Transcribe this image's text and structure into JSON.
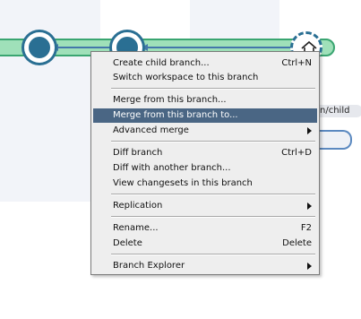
{
  "graph": {
    "child_branch_label": "n/child"
  },
  "context_menu": {
    "items": [
      {
        "label": "Create child branch...",
        "shortcut": "Ctrl+N"
      },
      {
        "label": "Switch workspace to this branch",
        "shortcut": ""
      },
      {
        "label": "Merge from this branch...",
        "shortcut": ""
      },
      {
        "label": "Merge from this branch to...",
        "shortcut": "",
        "selected": true
      },
      {
        "label": "Advanced merge",
        "shortcut": "",
        "submenu": true
      },
      {
        "label": "Diff branch",
        "shortcut": "Ctrl+D"
      },
      {
        "label": "Diff with another branch...",
        "shortcut": ""
      },
      {
        "label": "View changesets in this branch",
        "shortcut": ""
      },
      {
        "label": "Replication",
        "shortcut": "",
        "submenu": true
      },
      {
        "label": "Rename...",
        "shortcut": "F2"
      },
      {
        "label": "Delete",
        "shortcut": "Delete"
      },
      {
        "label": "Branch Explorer",
        "shortcut": "",
        "submenu": true
      }
    ]
  },
  "colors": {
    "branch_fill": "#9fe0b9",
    "branch_border": "#3aa571",
    "changeset": "#2a6f93",
    "selection": "#4a6684"
  },
  "icons": [
    "home-icon",
    "submenu-arrow-icon"
  ]
}
